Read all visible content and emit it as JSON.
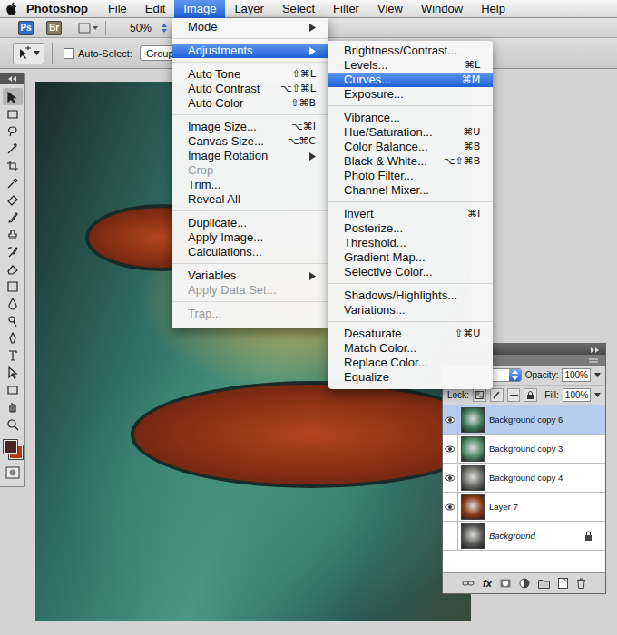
{
  "menubar": {
    "app": "Photoshop",
    "items": [
      {
        "label": "File",
        "selected": false
      },
      {
        "label": "Edit",
        "selected": false
      },
      {
        "label": "Image",
        "selected": true
      },
      {
        "label": "Layer",
        "selected": false
      },
      {
        "label": "Select",
        "selected": false
      },
      {
        "label": "Filter",
        "selected": false
      },
      {
        "label": "View",
        "selected": false
      },
      {
        "label": "Window",
        "selected": false
      },
      {
        "label": "Help",
        "selected": false
      }
    ]
  },
  "app_bar": {
    "badges": [
      {
        "label": "Ps",
        "color": "#2f6fd1"
      },
      {
        "label": "Br",
        "color": "#8a7a5e"
      }
    ],
    "zoom": "50%"
  },
  "options_bar": {
    "auto_select": {
      "label": "Auto-Select:",
      "checked": false
    },
    "target": "Group"
  },
  "toolbox": {
    "foreground": "#4a2521",
    "background": "#b0401a"
  },
  "image_menu": {
    "sections": [
      [
        {
          "label": "Mode",
          "submenu": true,
          "disabled": false,
          "selected": false
        }
      ],
      [
        {
          "label": "Adjustments",
          "submenu": true,
          "disabled": false,
          "selected": true
        }
      ],
      [
        {
          "label": "Auto Tone",
          "shortcut": "⇧⌘L",
          "submenu": false,
          "disabled": false,
          "selected": false
        },
        {
          "label": "Auto Contrast",
          "shortcut": "⌥⇧⌘L",
          "submenu": false,
          "disabled": false,
          "selected": false
        },
        {
          "label": "Auto Color",
          "shortcut": "⇧⌘B",
          "submenu": false,
          "disabled": false,
          "selected": false
        }
      ],
      [
        {
          "label": "Image Size...",
          "shortcut": "⌥⌘I",
          "submenu": false,
          "disabled": false,
          "selected": false
        },
        {
          "label": "Canvas Size...",
          "shortcut": "⌥⌘C",
          "submenu": false,
          "disabled": false,
          "selected": false
        },
        {
          "label": "Image Rotation",
          "submenu": true,
          "disabled": false,
          "selected": false
        },
        {
          "label": "Crop",
          "submenu": false,
          "disabled": true,
          "selected": false
        },
        {
          "label": "Trim...",
          "submenu": false,
          "disabled": false,
          "selected": false
        },
        {
          "label": "Reveal All",
          "submenu": false,
          "disabled": false,
          "selected": false
        }
      ],
      [
        {
          "label": "Duplicate...",
          "submenu": false,
          "disabled": false,
          "selected": false
        },
        {
          "label": "Apply Image...",
          "submenu": false,
          "disabled": false,
          "selected": false
        },
        {
          "label": "Calculations...",
          "submenu": false,
          "disabled": false,
          "selected": false
        }
      ],
      [
        {
          "label": "Variables",
          "submenu": true,
          "disabled": false,
          "selected": false
        },
        {
          "label": "Apply Data Set...",
          "submenu": false,
          "disabled": true,
          "selected": false
        }
      ],
      [
        {
          "label": "Trap...",
          "submenu": false,
          "disabled": true,
          "selected": false
        }
      ]
    ]
  },
  "adjustments_menu": {
    "sections": [
      [
        {
          "label": "Brightness/Contrast...",
          "submenu": false,
          "disabled": false,
          "selected": false
        },
        {
          "label": "Levels...",
          "shortcut": "⌘L",
          "submenu": false,
          "disabled": false,
          "selected": false
        },
        {
          "label": "Curves...",
          "shortcut": "⌘M",
          "submenu": false,
          "disabled": false,
          "selected": true
        },
        {
          "label": "Exposure...",
          "submenu": false,
          "disabled": false,
          "selected": false
        }
      ],
      [
        {
          "label": "Vibrance...",
          "submenu": false,
          "disabled": false,
          "selected": false
        },
        {
          "label": "Hue/Saturation...",
          "shortcut": "⌘U",
          "submenu": false,
          "disabled": false,
          "selected": false
        },
        {
          "label": "Color Balance...",
          "shortcut": "⌘B",
          "submenu": false,
          "disabled": false,
          "selected": false
        },
        {
          "label": "Black & White...",
          "shortcut": "⌥⇧⌘B",
          "submenu": false,
          "disabled": false,
          "selected": false
        },
        {
          "label": "Photo Filter...",
          "submenu": false,
          "disabled": false,
          "selected": false
        },
        {
          "label": "Channel Mixer...",
          "submenu": false,
          "disabled": false,
          "selected": false
        }
      ],
      [
        {
          "label": "Invert",
          "shortcut": "⌘I",
          "submenu": false,
          "disabled": false,
          "selected": false
        },
        {
          "label": "Posterize...",
          "submenu": false,
          "disabled": false,
          "selected": false
        },
        {
          "label": "Threshold...",
          "submenu": false,
          "disabled": false,
          "selected": false
        },
        {
          "label": "Gradient Map...",
          "submenu": false,
          "disabled": false,
          "selected": false
        },
        {
          "label": "Selective Color...",
          "submenu": false,
          "disabled": false,
          "selected": false
        }
      ],
      [
        {
          "label": "Shadows/Highlights...",
          "submenu": false,
          "disabled": false,
          "selected": false
        },
        {
          "label": "Variations...",
          "submenu": false,
          "disabled": false,
          "selected": false
        }
      ],
      [
        {
          "label": "Desaturate",
          "shortcut": "⇧⌘U",
          "submenu": false,
          "disabled": false,
          "selected": false
        },
        {
          "label": "Match Color...",
          "submenu": false,
          "disabled": false,
          "selected": false
        },
        {
          "label": "Replace Color...",
          "submenu": false,
          "disabled": false,
          "selected": false
        },
        {
          "label": "Equalize",
          "submenu": false,
          "disabled": false,
          "selected": false
        }
      ]
    ]
  },
  "layers_panel": {
    "opacity_label": "Opacity:",
    "opacity": "100%",
    "lock_label": "Lock:",
    "fill_label": "Fill:",
    "fill": "100%",
    "fx_label": "fx",
    "layers": [
      {
        "name": "Background copy 6",
        "selected": true,
        "visible": true,
        "locked": false,
        "italic": false,
        "color": "#3e7a5a"
      },
      {
        "name": "Background copy 3",
        "selected": false,
        "visible": true,
        "locked": false,
        "italic": false,
        "color": "#4f8a64"
      },
      {
        "name": "Background copy 4",
        "selected": false,
        "visible": true,
        "locked": false,
        "italic": false,
        "color": "#6c6c66"
      },
      {
        "name": "Layer 7",
        "selected": false,
        "visible": true,
        "locked": false,
        "italic": false,
        "color": "#8a3a15"
      },
      {
        "name": "Background",
        "selected": false,
        "visible": false,
        "locked": true,
        "italic": true,
        "color": "#5a5a58"
      }
    ]
  }
}
